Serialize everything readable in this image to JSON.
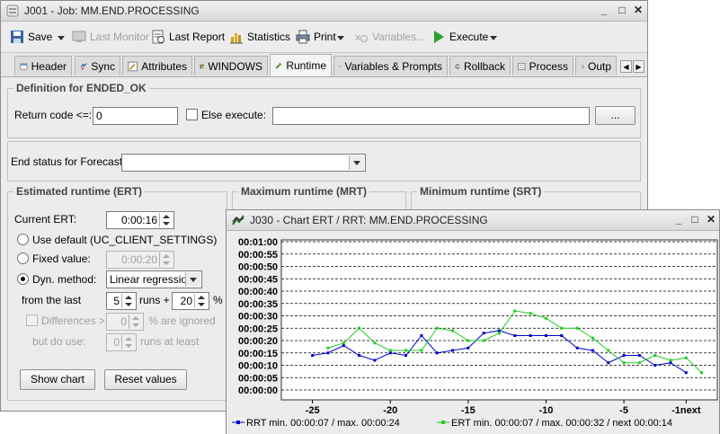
{
  "main_window": {
    "title": "J001 - Job: MM.END.PROCESSING",
    "toolbar": {
      "save": "Save",
      "last_monitor": "Last Monitor",
      "last_report": "Last Report",
      "statistics": "Statistics",
      "print": "Print",
      "variables": "Variables...",
      "execute": "Execute"
    },
    "tabs": [
      "Header",
      "Sync",
      "Attributes",
      "WINDOWS",
      "Runtime",
      "Variables & Prompts",
      "Rollback",
      "Process",
      "Outp"
    ],
    "active_tab": "Runtime",
    "definition": {
      "title": "Definition for ENDED_OK",
      "return_code_label": "Return code <=:",
      "return_code_value": "0",
      "else_execute_label": "Else execute:",
      "else_execute_value": "",
      "browse_button": "..."
    },
    "forecast": {
      "label": "End status for Forecast:",
      "value": ""
    },
    "ert": {
      "title": "Estimated runtime (ERT)",
      "current_label": "Current ERT:",
      "current_value": "0:00:16",
      "use_default_label": "Use default (UC_CLIENT_SETTINGS)",
      "fixed_value_label": "Fixed value:",
      "fixed_value": "0:00:20",
      "dyn_method_label": "Dyn. method:",
      "dyn_method_value": "Linear regression",
      "from_last_label": "from the last",
      "runs_value": "5",
      "runs_plus": "runs +",
      "percent_value": "20",
      "percent_sign": "%",
      "differences_label": "Differences >",
      "differences_value": "0",
      "ignored_label": "% are ignored",
      "but_do_use_label": "but do use:",
      "but_do_use_value": "0",
      "runs_at_least": "runs at least",
      "show_chart": "Show chart",
      "reset_values": "Reset values"
    },
    "mrt": {
      "title": "Maximum runtime (MRT)"
    },
    "srt": {
      "title": "Minimum runtime (SRT)"
    }
  },
  "chart_window": {
    "title": "J030 - Chart ERT / RRT: MM.END.PROCESSING",
    "legend": {
      "rrt": "RRT min. 00:00:07 / max. 00:00:24",
      "ert": "ERT min. 00:00:07 / max. 00:00:32 / next 00:00:14"
    }
  },
  "colors": {
    "rrt": "#0000cc",
    "ert": "#22cc22",
    "chart_bg": "#ffffff",
    "window_bg": "#ececec"
  },
  "chart_data": {
    "type": "line",
    "x_tick_labels": [
      "-25",
      "-20",
      "-15",
      "-10",
      "-5",
      "-1next"
    ],
    "x_ticks": [
      -25,
      -20,
      -15,
      -10,
      -5,
      -1
    ],
    "x_range": [
      -27,
      1
    ],
    "ylim": [
      0,
      60
    ],
    "y_tick_labels": [
      "00:00:00",
      "00:00:05",
      "00:00:10",
      "00:00:15",
      "00:00:20",
      "00:00:25",
      "00:00:30",
      "00:00:35",
      "00:00:40",
      "00:00:45",
      "00:00:50",
      "00:00:55",
      "00:01:00"
    ],
    "grid": "horizontal dashed",
    "legend_position": "bottom",
    "series": [
      {
        "name": "RRT",
        "x": [
          -25,
          -24,
          -23,
          -22,
          -21,
          -20,
          -19,
          -18,
          -17,
          -16,
          -15,
          -14,
          -13,
          -12,
          -11,
          -10,
          -9,
          -8,
          -7,
          -6,
          -5,
          -4,
          -3,
          -2,
          -1
        ],
        "values": [
          14,
          15,
          18,
          14,
          12,
          15,
          14,
          22,
          15,
          16,
          17,
          23,
          24,
          22,
          22,
          22,
          22,
          17,
          16,
          11,
          14,
          14,
          10,
          11,
          7
        ]
      },
      {
        "name": "ERT",
        "x": [
          -24,
          -23,
          -22,
          -21,
          -20,
          -19,
          -18,
          -17,
          -16,
          -15,
          -14,
          -13,
          -12,
          -11,
          -10,
          -9,
          -8,
          -7,
          -6,
          -5,
          -4,
          -3,
          -2,
          -1,
          0
        ],
        "values": [
          17,
          19,
          25,
          19,
          16,
          16,
          16,
          25,
          24,
          20,
          20,
          23,
          32,
          31,
          29,
          25,
          25,
          21,
          16,
          11,
          11,
          14,
          12,
          13,
          7
        ]
      }
    ]
  }
}
